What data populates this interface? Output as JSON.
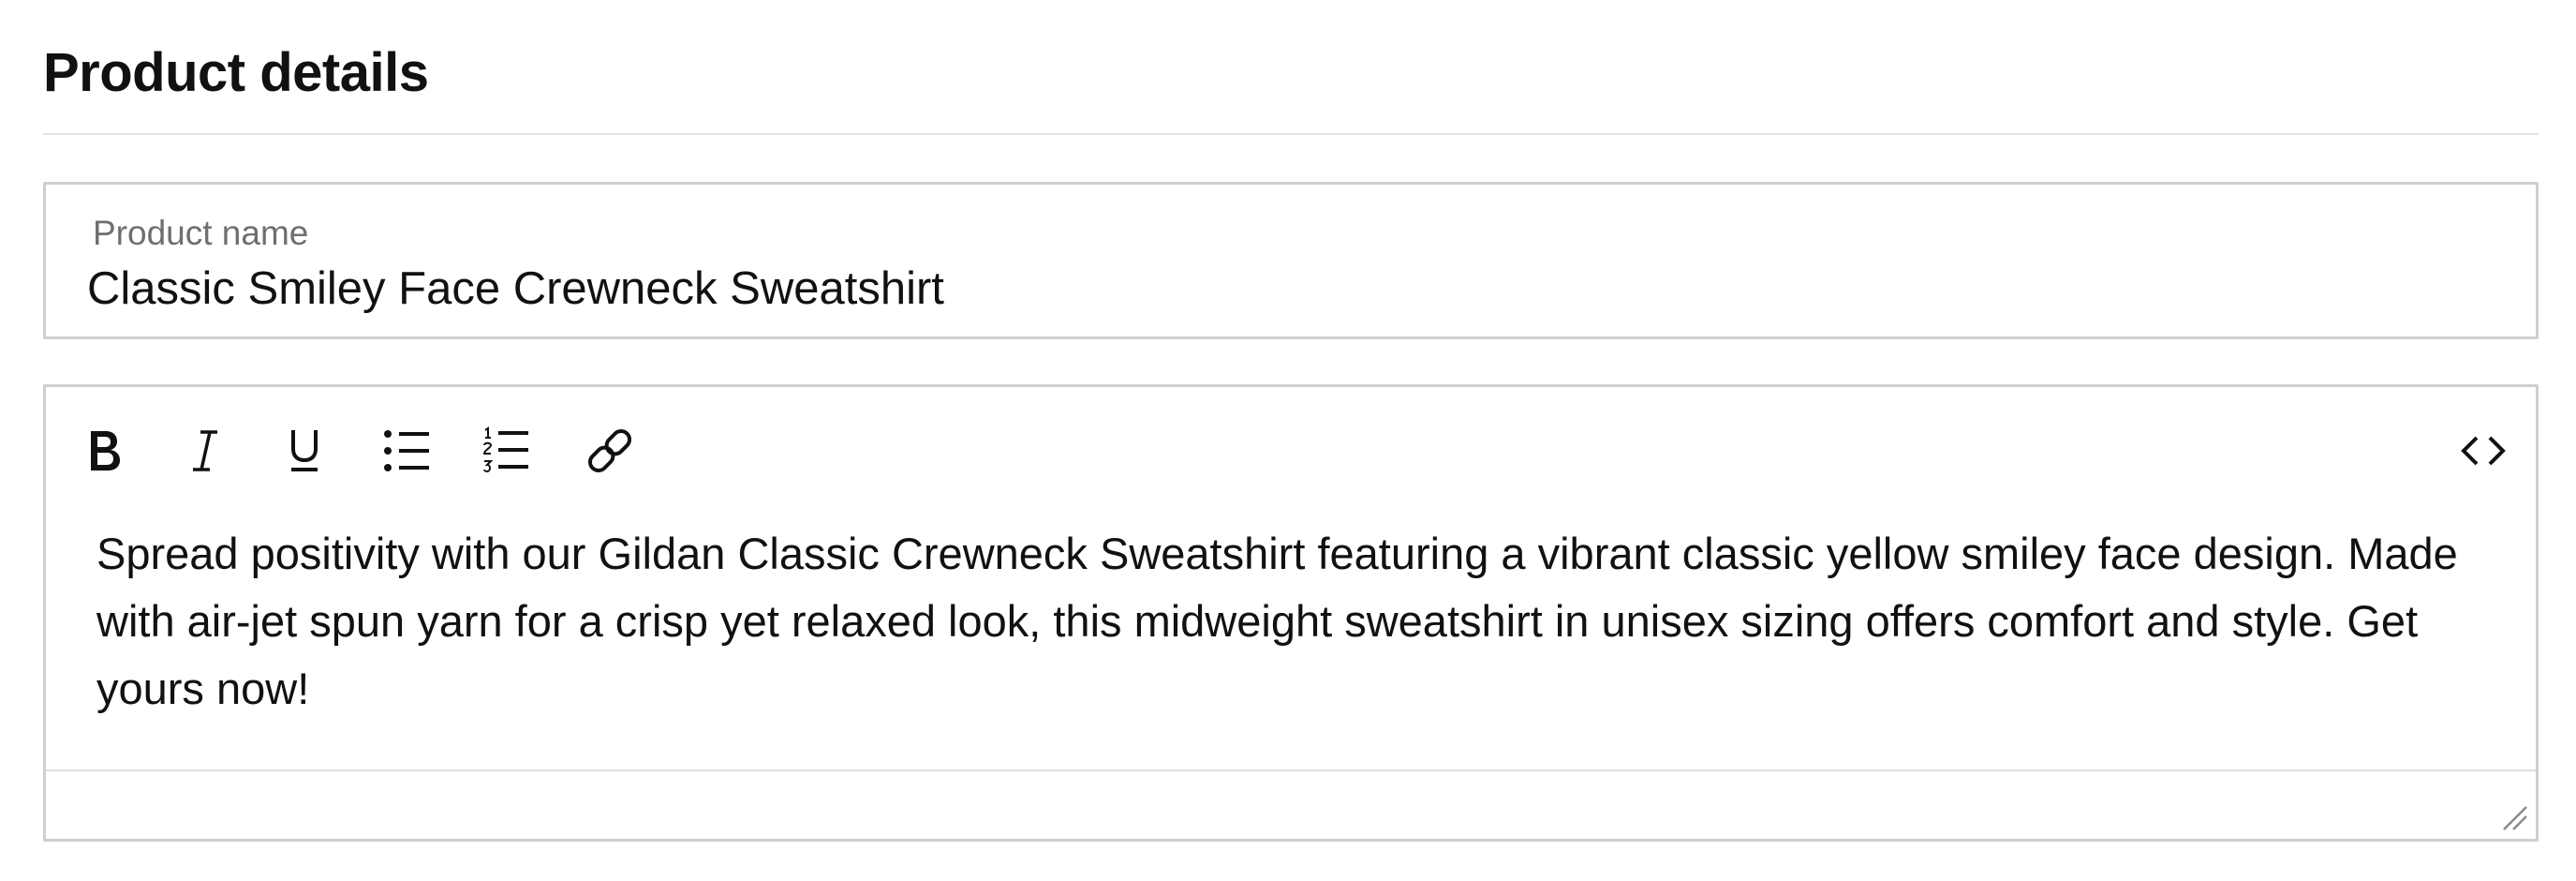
{
  "section": {
    "title": "Product details"
  },
  "product_name": {
    "label": "Product name",
    "value": "Classic Smiley Face Crewneck Sweatshirt"
  },
  "editor": {
    "toolbar": [
      {
        "action": "bold",
        "icon": "bold-icon"
      },
      {
        "action": "italic",
        "icon": "italic-icon"
      },
      {
        "action": "underline",
        "icon": "underline-icon"
      },
      {
        "action": "bulleted-list",
        "icon": "bulleted-list-icon"
      },
      {
        "action": "numbered-list",
        "icon": "numbered-list-icon"
      },
      {
        "action": "link",
        "icon": "link-icon"
      },
      {
        "action": "source-code",
        "icon": "code-icon"
      }
    ],
    "content": "Spread positivity with our Gildan Classic Crewneck Sweatshirt featuring a vibrant classic yellow smiley face design. Made with air-jet spun yarn for a crisp yet relaxed look, this midweight sweatshirt in unisex sizing offers comfort and style. Get yours now!"
  },
  "colors": {
    "text": "#111111",
    "label": "#6f6f6f",
    "border": "#cfcfcf",
    "divider": "#e3e3e3"
  }
}
